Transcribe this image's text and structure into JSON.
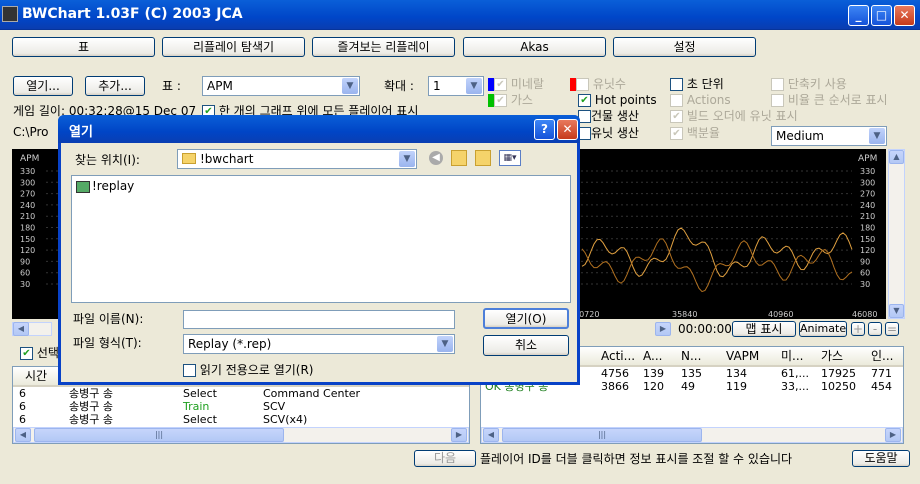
{
  "app": {
    "title": "BWChart 1.03F (C) 2003 JCA"
  },
  "tabs": [
    "표",
    "리플레이 탐색기",
    "즐겨보는 리플레이",
    "Akas",
    "설정"
  ],
  "toolbar": {
    "open_label": "열기...",
    "add_label": "추가...",
    "table_label": "표 :",
    "table_value": "APM",
    "zoom_label": "확대 :",
    "zoom_value": "1",
    "game_length": "게임 길이: 00:32:28@15 Dec 07",
    "one_graph_label": "한 개의 그래프 위에 모든 플레이어 표시",
    "path": "C:\\Pro"
  },
  "options": {
    "minerals": "미네랄",
    "gas": "가스",
    "supply_unit": "인구수",
    "units": "유닛수",
    "hotpoints": "Hot points",
    "building_prod": "건물 생산",
    "unit_prod": "유닛 생산",
    "seconds": "초 단위",
    "actions": "Actions",
    "build_order_units": "빌드 오더에 유닛 표시",
    "percent": "백분율",
    "hotkey_use": "단축키 사용",
    "ratio_sort": "비율 큰 순서로 표시",
    "smooth_value": "Medium"
  },
  "chart_left": {
    "ylabel": "APM",
    "ticks": [
      "330",
      "300",
      "270",
      "240",
      "210",
      "180",
      "150",
      "120",
      "90",
      "60",
      "30"
    ]
  },
  "chart_right": {
    "ylabel": "APM",
    "ticks": [
      "330",
      "300",
      "270",
      "240",
      "210",
      "180",
      "150",
      "120",
      "90",
      "60",
      "30"
    ],
    "xticks": [
      "30720",
      "35840",
      "40960",
      "46080"
    ]
  },
  "timeline": {
    "time": "00:00:00",
    "map_label": "맵 표시",
    "animate_label": "Animate",
    "plus": "+",
    "minus": "-",
    "eq": "="
  },
  "left_list": {
    "select_label": "선택",
    "col_time": "시간",
    "rows": [
      {
        "t": "6",
        "player": "송병구 송",
        "action": "Select",
        "target": "Command Center"
      },
      {
        "t": "6",
        "player": "송병구 송",
        "action": "Train",
        "target": "SCV"
      },
      {
        "t": "6",
        "player": "송병구 송",
        "action": "Select",
        "target": "SCV(x4)"
      }
    ]
  },
  "right_list": {
    "columns": [
      "Acti...",
      "A...",
      "N...",
      "VAPM",
      "미...",
      "가스",
      "인..."
    ],
    "rows": [
      {
        "name": "",
        "vals": [
          "4756",
          "139",
          "135",
          "134",
          "61,...",
          "17925",
          "771"
        ]
      },
      {
        "name": "OK 송병구 송",
        "vals": [
          "3866",
          "120",
          "49",
          "119",
          "33,...",
          "10250",
          "454"
        ]
      }
    ]
  },
  "status": {
    "next_label": "다음",
    "hint": "플레이어 ID를 더블 클릭하면 정보 표시를 조절 할 수 있습니다",
    "help_label": "도움말"
  },
  "dialog": {
    "title": "열기",
    "look_in_label": "찾는 위치(I):",
    "look_in_value": "!bwchart",
    "items": [
      "!replay"
    ],
    "filename_label": "파일 이름(N):",
    "filename_value": "",
    "filetype_label": "파일 형식(T):",
    "filetype_value": "Replay (*.rep)",
    "readonly_label": "읽기 전용으로 열기(R)",
    "open_button": "열기(O)",
    "cancel_button": "취소"
  },
  "colors": {
    "minerals": "#0000FF",
    "gas": "#00C000",
    "units": "#FF0000",
    "chart_line_1": "#E0A040",
    "chart_line_2": "#C07820"
  }
}
